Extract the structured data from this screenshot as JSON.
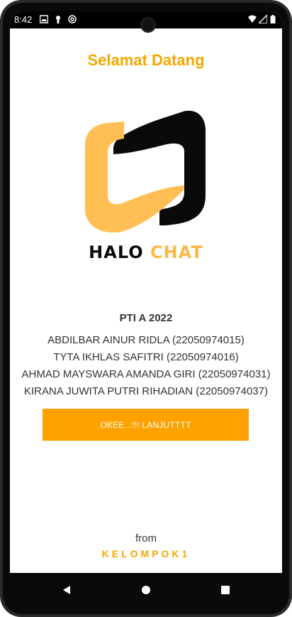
{
  "status_bar": {
    "time": "8:42",
    "icons": [
      "gallery-icon",
      "lock-icon",
      "vpn-icon",
      "wifi-icon",
      "signal-icon",
      "battery-icon"
    ]
  },
  "welcome": "Selamat Datang",
  "brand": {
    "part1": "HALO",
    "part2": "CHAT",
    "colors": {
      "dark": "#0a0a0a",
      "accent": "#ffb845"
    }
  },
  "class_title": "PTI A 2022",
  "members": [
    "ABDILBAR AINUR RIDLA (22050974015)",
    "TYTA IKHLAS SAFITRI (22050974016)",
    "AHMAD MAYSWARA AMANDA GIRI (22050974031)",
    "KIRANA JUWITA PUTRI RIHADIAN (22050974037)"
  ],
  "cta": {
    "label": "OKEE...!!! LANJUTTTT",
    "color": "#ffa200"
  },
  "footer": {
    "from": "from",
    "group": "KELOMPOK1"
  },
  "navbar": {
    "icons": [
      "back-icon",
      "home-icon",
      "recents-icon"
    ]
  }
}
